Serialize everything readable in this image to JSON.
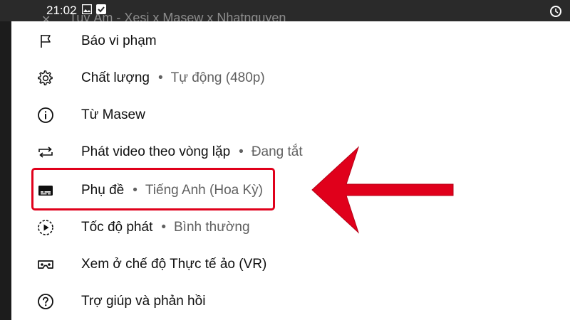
{
  "status_bar": {
    "time": "21:02",
    "video_title": "Tuy Âm - Xesi x Masew x Nhatnguyen"
  },
  "menu": {
    "items": [
      {
        "label": "Báo vi phạm",
        "value": "",
        "icon": "flag-icon"
      },
      {
        "label": "Chất lượng",
        "value": "Tự động (480p)",
        "icon": "gear-icon"
      },
      {
        "label": "Từ Masew",
        "value": "",
        "icon": "info-icon"
      },
      {
        "label": "Phát video theo vòng lặp",
        "value": "Đang tắt",
        "icon": "loop-icon"
      },
      {
        "label": "Phụ đề",
        "value": "Tiếng Anh (Hoa Kỳ)",
        "icon": "subtitles-icon"
      },
      {
        "label": "Tốc độ phát",
        "value": "Bình thường",
        "icon": "playback-speed-icon"
      },
      {
        "label": "Xem ở chế độ Thực tế ảo (VR)",
        "value": "",
        "icon": "vr-cardboard-icon"
      },
      {
        "label": "Trợ giúp và phản hồi",
        "value": "",
        "icon": "help-icon"
      }
    ],
    "separator": "•"
  },
  "annotation": {
    "highlight_color": "#e0001b",
    "arrow_color": "#e0001b"
  }
}
